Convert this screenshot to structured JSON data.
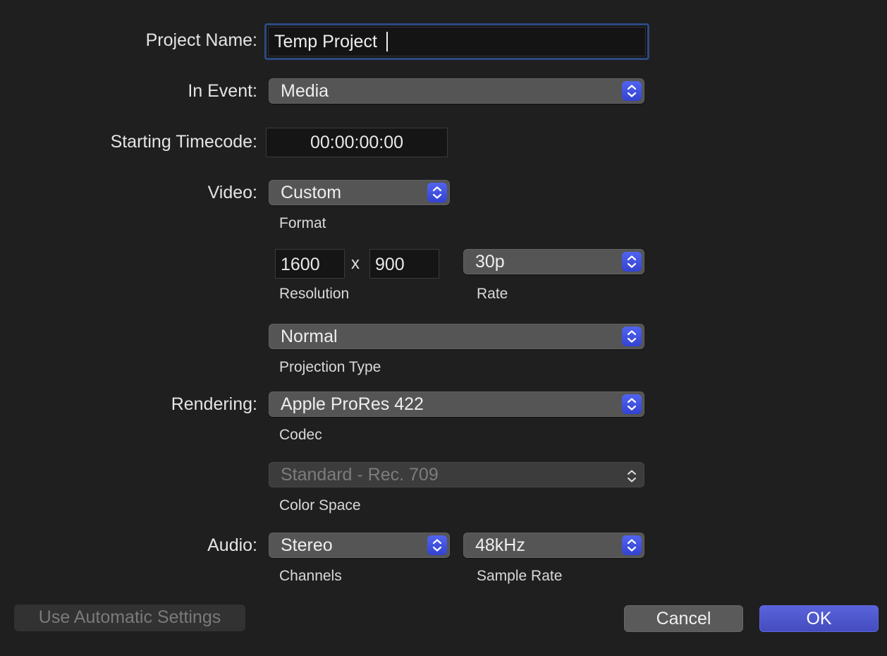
{
  "project_name": {
    "label": "Project Name:",
    "value": "Temp Project"
  },
  "in_event": {
    "label": "In Event:",
    "value": "Media"
  },
  "starting_timecode": {
    "label": "Starting Timecode:",
    "value": "00:00:00:00"
  },
  "video": {
    "label": "Video:",
    "format": {
      "value": "Custom",
      "caption": "Format"
    },
    "resolution": {
      "width": "1600",
      "separator": "x",
      "height": "900",
      "caption": "Resolution"
    },
    "rate": {
      "value": "30p",
      "caption": "Rate"
    },
    "projection": {
      "value": "Normal",
      "caption": "Projection Type"
    }
  },
  "rendering": {
    "label": "Rendering:",
    "codec": {
      "value": "Apple ProRes 422",
      "caption": "Codec"
    },
    "color_space": {
      "value": "Standard - Rec. 709",
      "caption": "Color Space",
      "disabled": true
    }
  },
  "audio": {
    "label": "Audio:",
    "channels": {
      "value": "Stereo",
      "caption": "Channels"
    },
    "sample_rate": {
      "value": "48kHz",
      "caption": "Sample Rate"
    }
  },
  "buttons": {
    "use_automatic": "Use Automatic Settings",
    "cancel": "Cancel",
    "ok": "OK"
  },
  "colors": {
    "accent": "#3f4fe0",
    "ok_button": "#4a52c8",
    "background": "#1f1f1f"
  }
}
